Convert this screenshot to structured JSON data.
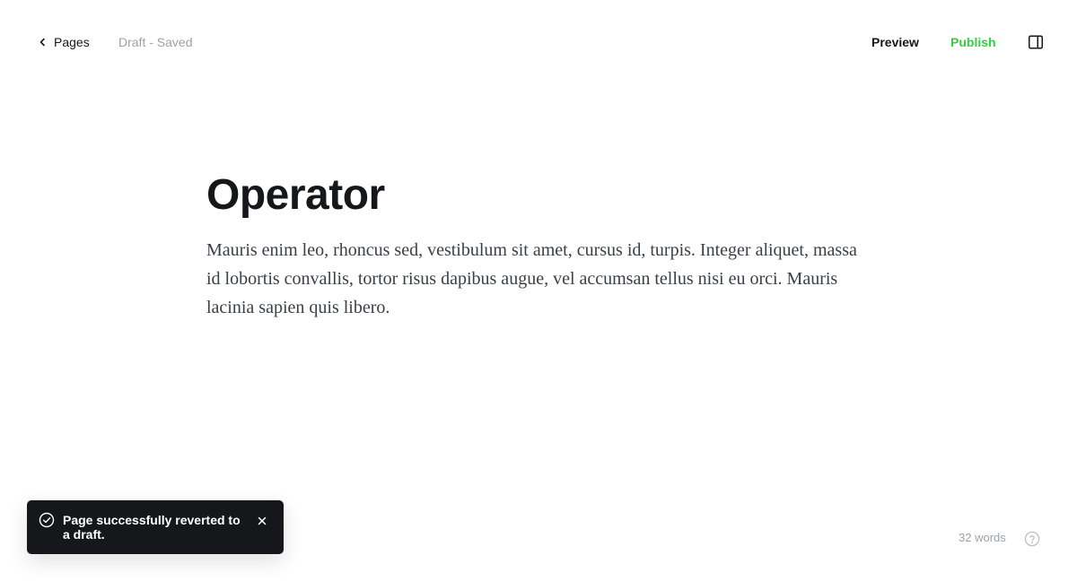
{
  "header": {
    "back_label": "Pages",
    "status": "Draft - Saved",
    "preview_label": "Preview",
    "publish_label": "Publish"
  },
  "post": {
    "title": "Operator",
    "body": "Mauris enim leo, rhoncus sed, vestibulum sit amet, cursus id, turpis. Integer aliquet, massa id lobortis convallis, tortor risus dapibus augue, vel accumsan tellus nisi eu orci. Mauris lacinia sapien quis libero."
  },
  "toast": {
    "message": "Page successfully reverted to a draft.",
    "icon": "check-circle-icon",
    "close_icon": "close-icon"
  },
  "footer": {
    "word_count": "32 words",
    "help_icon": "help-circle-icon"
  },
  "colors": {
    "accent": "#30cf43",
    "text": "#15171a",
    "muted": "#9aa2ab",
    "toast_bg": "#15171a"
  }
}
